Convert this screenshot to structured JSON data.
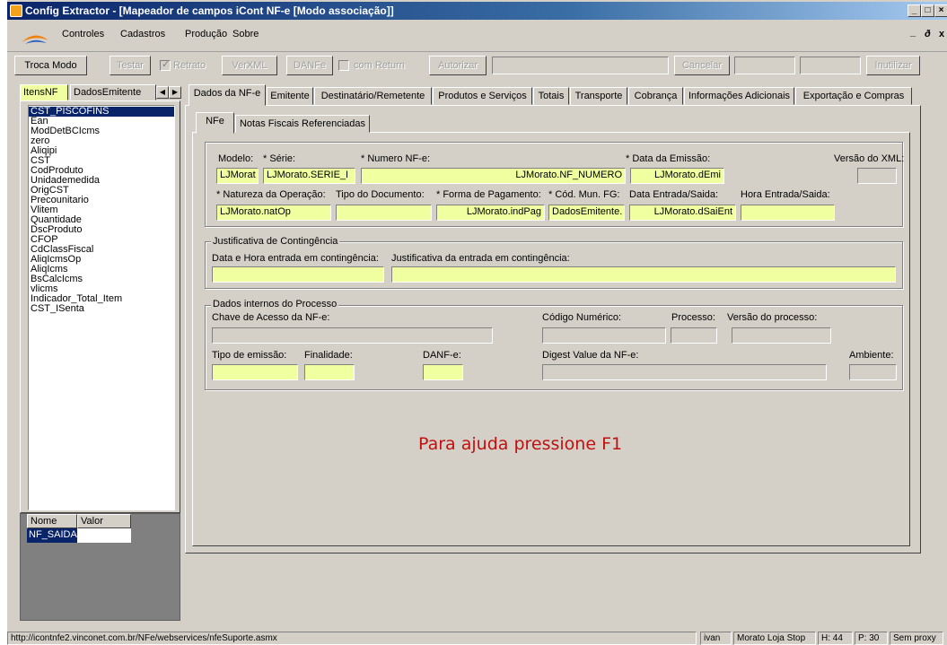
{
  "window": {
    "title": "Config Extractor - [Mapeador de campos iCont NF-e [Modo associação]]"
  },
  "menu": {
    "items": [
      "Controles",
      "Cadastros",
      "Produção",
      "Sobre"
    ],
    "mdi_controls": [
      "_",
      "ₐ",
      "x"
    ]
  },
  "toolbar": {
    "troca_modo": "Troca Modo",
    "testar": "Testar",
    "retrato": "Retrato",
    "ver_xml": "VerXML",
    "danfe": "DANFe",
    "com_return": "com Return",
    "autorizar": "Autorizar",
    "cancelar": "Cancelar",
    "inutilizar": "Inutilizar"
  },
  "left_tabs": [
    "ItensNF",
    "DadosEmitente"
  ],
  "field_list": {
    "items": [
      "CST_PISCOFINS",
      "Ean",
      "ModDetBCIcms",
      "zero",
      "Aliqipi",
      "CST",
      "CodProduto",
      "Unidademedida",
      "OrigCST",
      "Precounitario",
      "Vlitem",
      "Quantidade",
      "DscProduto",
      "CFOP",
      "CdClassFiscal",
      "AliqIcmsOp",
      "AliqIcms",
      "BsCalcIcms",
      "vlicms",
      "Indicador_Total_Item",
      "CST_ISenta"
    ],
    "selected_index": 0
  },
  "prop_grid": {
    "col_nome": "Nome",
    "col_valor": "Valor",
    "row_nome": "NF_SAIDA",
    "row_valor": ""
  },
  "main_tabs": [
    "Dados da NF-e",
    "Emitente",
    "Destinatário/Remetente",
    "Produtos e Serviços",
    "Totais",
    "Transporte",
    "Cobrança",
    "Informações Adicionais",
    "Exportação e Compras"
  ],
  "sub_tabs": [
    "NFe",
    "Notas Fiscais Referenciadas"
  ],
  "nfe": {
    "modelo_label": "Modelo:",
    "modelo_value": "LJMorat",
    "serie_label": "* Série:",
    "serie_value": "LJMorato.SERIE_I",
    "numero_label": "* Numero NF-e:",
    "numero_value": "LJMorato.NF_NUMERO",
    "emissao_label": "* Data da Emissão:",
    "emissao_value": "LJMorato.dEmi",
    "versao_label": "Versão do XML:",
    "natureza_label": "* Natureza da Operação:",
    "natureza_value": "LJMorato.natOp",
    "tipo_doc_label": "Tipo do Documento:",
    "forma_pag_label": "* Forma de Pagamento:",
    "forma_pag_value": "LJMorato.indPag",
    "cod_mun_label": "* Cód. Mun. FG:",
    "cod_mun_value": "DadosEmitente.",
    "data_saida_label": "Data Entrada/Saida:",
    "data_saida_value": "LJMorato.dSaiEnt",
    "hora_saida_label": "Hora Entrada/Saida:"
  },
  "contingencia": {
    "title": "Justificativa de Contingência",
    "data_hora_label": "Data e Hora entrada em contingência:",
    "justificativa_label": "Justificativa da entrada em contingência:"
  },
  "processo": {
    "title": "Dados internos do Processo",
    "chave_label": "Chave de Acesso da NF-e:",
    "codigo_label": "Código Numérico:",
    "processo_label": "Processo:",
    "versao_proc_label": "Versão do processo:",
    "tipo_emissao_label": "Tipo de emissão:",
    "finalidade_label": "Finalidade:",
    "danfe_label": "DANF-e:",
    "digest_label": "Digest Value da NF-e:",
    "ambiente_label": "Ambiente:"
  },
  "help_text": "Para ajuda pressione F1",
  "status": {
    "url": "http://icontnfe2.vinconet.com.br/NFe/webservices/nfeSuporte.asmx",
    "user": "ivan",
    "store": "Morato Loja Stop",
    "h": "H: 44",
    "p": "P: 30",
    "proxy": "Sem proxy"
  },
  "colors": {
    "title_bar": "#0a246a",
    "field_yellow": "#f0ffa0",
    "help_red": "#c01010",
    "selection": "#0a246a"
  }
}
